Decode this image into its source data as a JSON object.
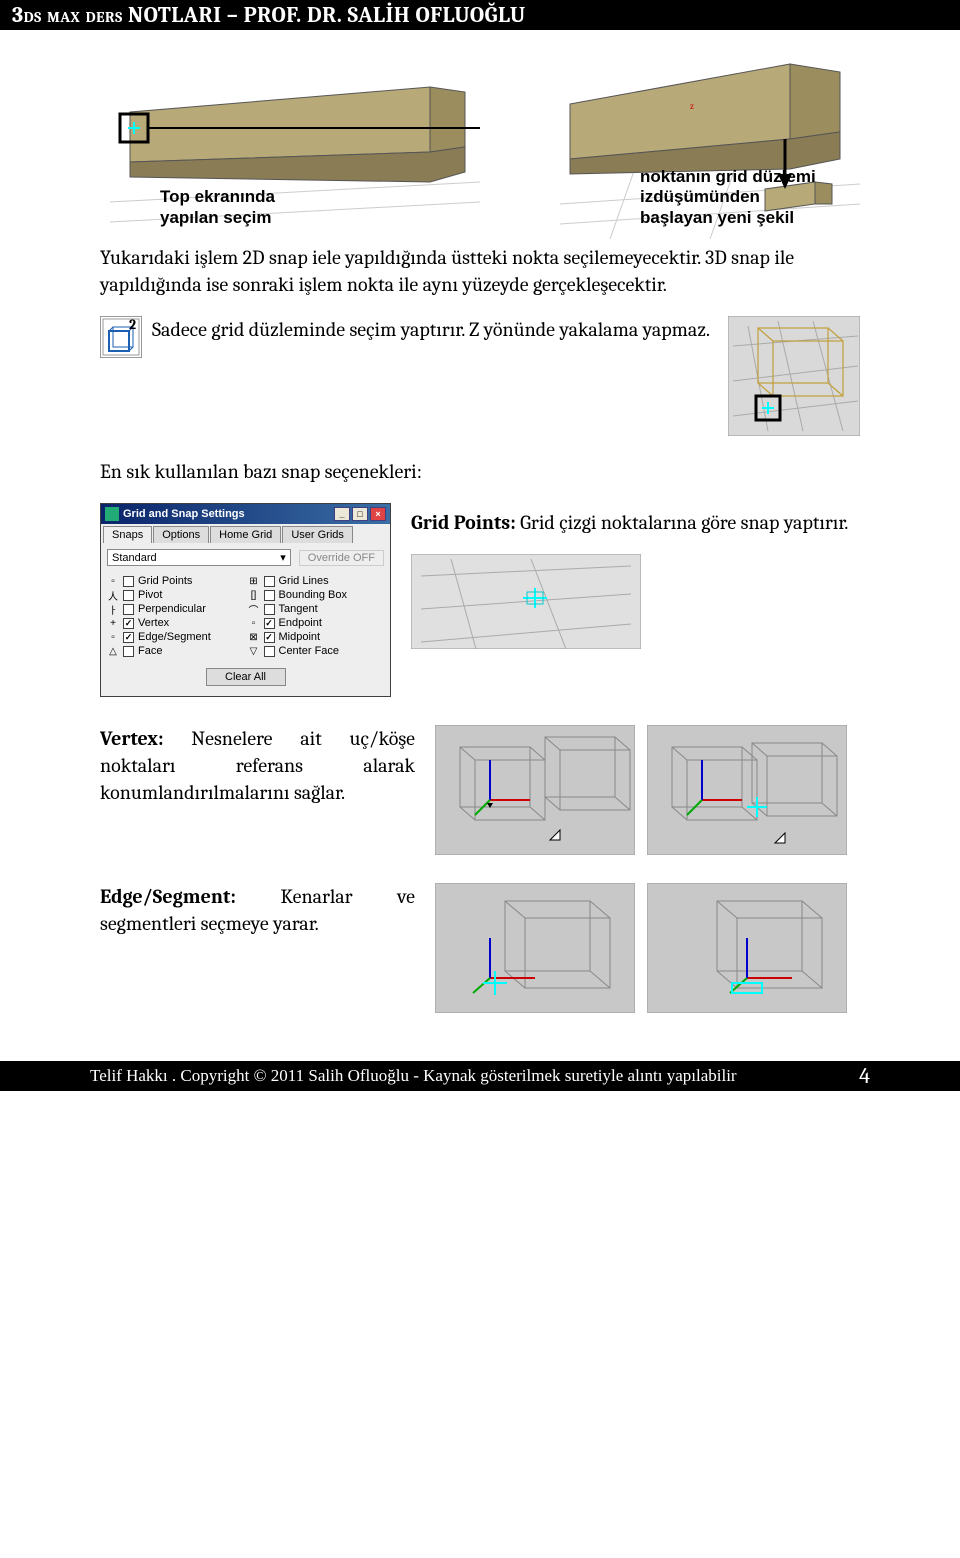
{
  "header": {
    "title": "3ds max ders NOTLARI – PROF. DR. SALİH OFLUOĞLU"
  },
  "fig_left_caption_line1": "Top ekranında",
  "fig_left_caption_line2": "yapılan seçim",
  "fig_right_caption_line1": "noktanın grid düzlemi",
  "fig_right_caption_line2": "izdüşümünden",
  "fig_right_caption_line3": "başlayan yeni şekil",
  "para1": "Yukarıdaki işlem 2D snap iele yapıldığında üstteki nokta seçilemeyecektir. 3D snap ile yapıldığında ise sonraki işlem nokta ile aynı yüzeyde gerçekleşecektir.",
  "para2": "Sadece grid düzleminde seçim yaptırır. Z yönünde yakalama yapmaz.",
  "para3": "En sık kullanılan bazı snap seçenekleri:",
  "icon2_label": "2",
  "dialog": {
    "title": "Grid and Snap Settings",
    "tabs": [
      "Snaps",
      "Options",
      "Home Grid",
      "User Grids"
    ],
    "dropdown_value": "Standard",
    "override_label": "Override OFF",
    "left_options": [
      {
        "icon": "▢",
        "checked": false,
        "label": "Grid Points"
      },
      {
        "icon": "人",
        "checked": false,
        "label": "Pivot"
      },
      {
        "icon": "ㅏ",
        "checked": false,
        "label": "Perpendicular"
      },
      {
        "icon": "+",
        "checked": true,
        "label": "Vertex"
      },
      {
        "icon": "▢",
        "checked": true,
        "label": "Edge/Segment"
      },
      {
        "icon": "△",
        "checked": false,
        "label": "Face"
      }
    ],
    "right_options": [
      {
        "icon": "⊞",
        "checked": false,
        "label": "Grid Lines"
      },
      {
        "icon": "[]",
        "checked": false,
        "label": "Bounding Box"
      },
      {
        "icon": "⌒",
        "checked": false,
        "label": "Tangent"
      },
      {
        "icon": "▢",
        "checked": true,
        "label": "Endpoint"
      },
      {
        "icon": "⊠",
        "checked": true,
        "label": "Midpoint"
      },
      {
        "icon": "▽",
        "checked": false,
        "label": "Center Face"
      }
    ],
    "clear_label": "Clear All"
  },
  "grid_points_label": "Grid Points:",
  "grid_points_text": " Grid çizgi noktalarına göre snap yaptırır.",
  "vertex_label": "Vertex:",
  "vertex_text_rest": " Nesnelere ait uç/köşe noktaları referans alarak konumlandırılmalarını sağlar.",
  "edge_label": "Edge/Segment:",
  "edge_text_rest": " Kenarlar ve segmentleri seçmeye yarar.",
  "footer": {
    "copyright": "Telif Hakkı . Copyright © 2011 Salih Ofluoğlu - Kaynak gösterilmek suretiyle alıntı yapılabilir",
    "page": "4"
  }
}
